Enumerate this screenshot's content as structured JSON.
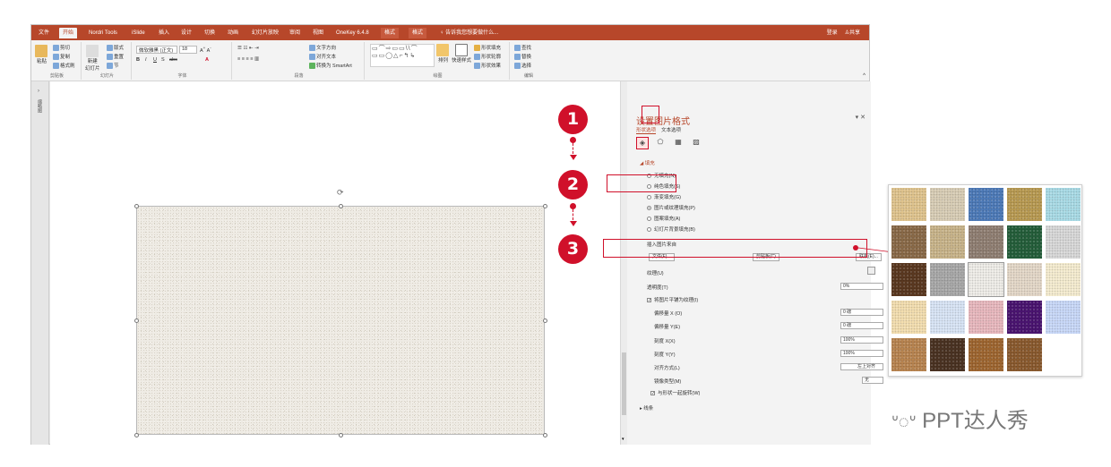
{
  "ribbon_tabs": [
    "文件",
    "开始",
    "Nordri Tools",
    "iSlide",
    "插入",
    "设计",
    "切换",
    "动画",
    "幻灯片放映",
    "审阅",
    "视图",
    "OneKey 6.4.8",
    "格式",
    "格式"
  ],
  "tell_me": "告诉我您想要做什么...",
  "title_right": {
    "signin": "登录",
    "share": "共享"
  },
  "ribbon": {
    "clipboard": {
      "paste": "粘贴",
      "cut": "剪切",
      "copy": "复制",
      "format_painter": "格式刷",
      "label": "剪贴板"
    },
    "slides": {
      "new": "新建",
      "new2": "幻灯片",
      "layout": "版式",
      "reset": "重置",
      "section": "节",
      "label": "幻灯片"
    },
    "font": {
      "name": "微软雅黑 (正文)",
      "size": "18",
      "label": "字体",
      "b": "B",
      "i": "I",
      "u": "U",
      "s": "S",
      "abc": "abc"
    },
    "paragraph": {
      "text_dir": "文字方向",
      "align_text": "对齐文本",
      "smartart": "转换为 SmartArt",
      "label": "段落"
    },
    "drawing": {
      "arrange": "排列",
      "quick_styles": "快速样式",
      "fill": "形状填充",
      "outline": "形状轮廓",
      "effects": "形状效果",
      "label": "绘图"
    },
    "editing": {
      "find": "查找",
      "replace": "替换",
      "select": "选择",
      "label": "编辑"
    }
  },
  "thumbnail_label": "缩略图",
  "pane": {
    "title": "设置图片格式",
    "tab_shape": "形状选项",
    "tab_text": "文本选项",
    "section_fill": "填充",
    "options": [
      "无填充(N)",
      "纯色填充(S)",
      "渐变填充(G)",
      "图片或纹理填充(P)",
      "图案填充(A)",
      "幻灯片背景填充(B)"
    ],
    "selected_option": 3,
    "insert_from": "插入图片来自",
    "btn_file": "文件(F)...",
    "btn_clipboard": "剪贴板(C)",
    "btn_online": "联机(E)...",
    "texture_label": "纹理(U)",
    "transparency_label": "透明度(T)",
    "transparency_value": "0%",
    "tile_label": "将图片平铺为纹理(I)",
    "offset_x_label": "偏移量 X (O)",
    "offset_x": "0 磅",
    "offset_y_label": "偏移量 Y(E)",
    "offset_y": "0 磅",
    "scale_x_label": "刻度 X(X)",
    "scale_x": "100%",
    "scale_y_label": "刻度 Y(Y)",
    "scale_y": "100%",
    "align_label": "对齐方式(L)",
    "align_value": "左上对齐",
    "mirror_label": "镜像类型(M)",
    "mirror_value": "无",
    "rotate_label": "与形状一起旋转(W)",
    "section_line": "线条"
  },
  "steps": [
    "1",
    "2",
    "3"
  ],
  "accent": "#d0102a",
  "brand": "#b7472a",
  "texture_colors": [
    "#e0c48e",
    "#d8cdb5",
    "#4d7ab8",
    "#b89a52",
    "#a9dbe6",
    "#8a6a48",
    "#c8b48a",
    "#8f7e72",
    "#245e3a",
    "#d8d8d8",
    "#5a3820",
    "#a8a8a8",
    "#efede8",
    "#e4d8c8",
    "#f5ecd0",
    "#f3deb0",
    "#d8e4f5",
    "#e8b8be",
    "#4a1470",
    "#c8d8f8",
    "#b88450",
    "#4a3222",
    "#9e6630",
    "#8a5a2e"
  ],
  "watermark": "PPT达人秀"
}
